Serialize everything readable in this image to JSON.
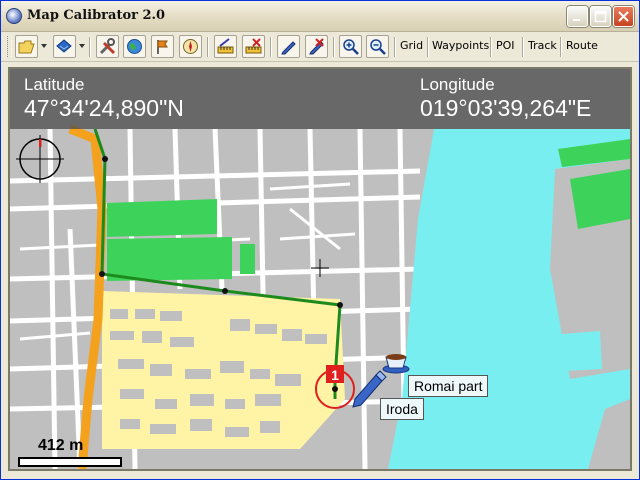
{
  "window": {
    "title": "Map Calibrator 2.0"
  },
  "toolbar": {
    "icons": [
      "open-folder-icon",
      "layers-icon",
      "tools-icon",
      "globe-icon",
      "flag-icon",
      "compass-icon",
      "ruler-icon",
      "ruler-delete-icon",
      "pen-icon",
      "pen-delete-icon",
      "zoom-in-icon",
      "zoom-out-icon"
    ],
    "grid_label": "Grid",
    "waypoints_label": "Waypoints",
    "poi_label": "POI",
    "track_label": "Track",
    "route_label": "Route"
  },
  "coordinates": {
    "latitude_label": "Latitude",
    "latitude_value": "47°34'24,890\"N",
    "longitude_label": "Longitude",
    "longitude_value": "019°03'39,264\"E"
  },
  "map": {
    "colors": {
      "land": "#bfbfbf",
      "street": "#ffffff",
      "water": "#79eef0",
      "park": "#3dd35b",
      "main_road": "#f4a21d",
      "route": "#1c8a1c",
      "buildings": "#fff4a6"
    },
    "waypoint_number": "1",
    "poi_labels": {
      "cafe": "Romai part",
      "office": "Iroda"
    },
    "scale_text": "412 m"
  }
}
